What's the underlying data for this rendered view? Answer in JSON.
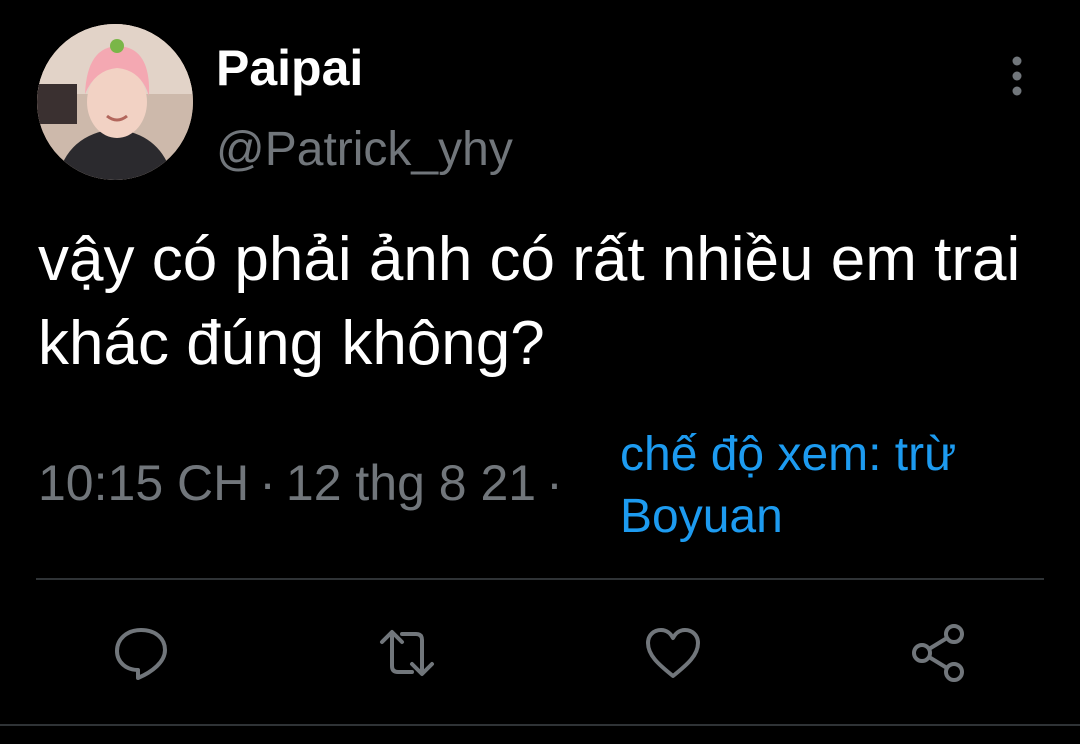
{
  "tweet": {
    "author": {
      "display_name": "Paipai",
      "handle": "@Patrick_yhy"
    },
    "text": "vậy có phải ảnh có rất nhiều em trai khác đúng không?",
    "time": "10:15 CH",
    "separator": "·",
    "date": "12 thg 8 21",
    "source": "chế độ xem: trừ Boyuan"
  },
  "actions": {
    "icons": [
      "reply-icon",
      "retweet-icon",
      "like-icon",
      "share-icon"
    ]
  },
  "colors": {
    "background": "#000000",
    "primary_text": "#ffffff",
    "secondary_text": "#71767b",
    "accent": "#1d9bf0",
    "divider": "#2f3336"
  }
}
